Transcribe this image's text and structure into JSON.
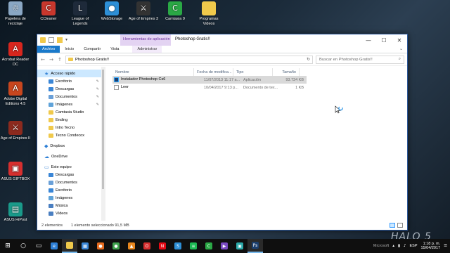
{
  "desktop_icons": [
    {
      "label": "Papelera de reciclaje",
      "icon": "recycle-bin-icon",
      "color": "#8aa7c4",
      "glyph": "♲"
    },
    {
      "label": "CCleaner",
      "icon": "ccleaner-icon",
      "color": "#c8372d",
      "glyph": "C"
    },
    {
      "label": "League of Legends",
      "icon": "league-of-legends-icon",
      "color": "#1e2a3a",
      "glyph": "L"
    },
    {
      "label": "WebStorage",
      "icon": "webstorage-icon",
      "color": "#2d8fd6",
      "glyph": "●"
    },
    {
      "label": "Age of Empires 3",
      "icon": "age-of-empires-3-icon",
      "color": "#333333",
      "glyph": "⚔"
    },
    {
      "label": "Camtasia 9",
      "icon": "camtasia-icon",
      "color": "#2aa845",
      "glyph": "C"
    },
    {
      "label": "Programas Videos",
      "icon": "folder-icon",
      "color": "#f0c94b",
      "glyph": ""
    },
    {
      "label": "Acrobat Reader DC",
      "icon": "acrobat-reader-icon",
      "color": "#d7261e",
      "glyph": "A"
    },
    {
      "label": "Adobe Digital Editions 4.5",
      "icon": "adobe-digital-editions-icon",
      "color": "#c8461e",
      "glyph": "A"
    },
    {
      "label": "Age of Empires II",
      "icon": "age-of-empires-2-icon",
      "color": "#8c2a1e",
      "glyph": "⚔"
    },
    {
      "label": "ASUS GIFTBOX",
      "icon": "asus-giftbox-icon",
      "color": "#d62f2f",
      "glyph": "▣"
    },
    {
      "label": "ASUS HiPost",
      "icon": "asus-hipost-icon",
      "color": "#1a9a8a",
      "glyph": "▤"
    }
  ],
  "window": {
    "context_tab": "Herramientas de aplicación",
    "title": "Photoshop Gratis!!",
    "controls": {
      "minimize": "—",
      "maximize": "☐",
      "close": "✕"
    }
  },
  "ribbon": {
    "tabs": [
      "Archivo",
      "Inicio",
      "Compartir",
      "Vista"
    ],
    "manage": "Administrar",
    "expand": "⌄"
  },
  "address": {
    "back": "←",
    "forward": "→",
    "up": "↑",
    "path": "Photoshop Gratis!!",
    "refresh": "↻",
    "search_placeholder": "Buscar en Photoshop Gratis!!",
    "search_icon": "⌕"
  },
  "nav": {
    "quick_access": "Acceso rápido",
    "quick_items": [
      {
        "label": "Escritorio",
        "icon": "desktop-icon",
        "color": "#3a86d6",
        "pinned": true
      },
      {
        "label": "Descargas",
        "icon": "downloads-icon",
        "color": "#3a86d6",
        "pinned": true
      },
      {
        "label": "Documentos",
        "icon": "documents-icon",
        "color": "#6aa0d8",
        "pinned": true
      },
      {
        "label": "Imágenes",
        "icon": "pictures-icon",
        "color": "#5fa3d9",
        "pinned": true
      },
      {
        "label": "Camtasia Studio",
        "icon": "folder-icon",
        "color": "#f0c94b",
        "pinned": false
      },
      {
        "label": "Ending",
        "icon": "folder-icon",
        "color": "#f0c94b",
        "pinned": false
      },
      {
        "label": "Intro Tecno",
        "icon": "folder-icon",
        "color": "#f0c94b",
        "pinned": false
      },
      {
        "label": "Tecno Condecox",
        "icon": "folder-icon",
        "color": "#f0c94b",
        "pinned": false
      }
    ],
    "pin_glyph": "✎",
    "dropbox": "Dropbox",
    "onedrive": "OneDrive",
    "this_pc": "Este equipo",
    "pc_items": [
      {
        "label": "Descargas",
        "icon": "downloads-icon",
        "color": "#3a86d6"
      },
      {
        "label": "Documentos",
        "icon": "documents-icon",
        "color": "#6aa0d8"
      },
      {
        "label": "Escritorio",
        "icon": "desktop-icon",
        "color": "#3a86d6"
      },
      {
        "label": "Imágenes",
        "icon": "pictures-icon",
        "color": "#5fa3d9"
      },
      {
        "label": "Música",
        "icon": "music-icon",
        "color": "#4a7fc1"
      },
      {
        "label": "Vídeos",
        "icon": "videos-icon",
        "color": "#4a7fc1"
      }
    ]
  },
  "columns": {
    "name": "Nombre",
    "date": "Fecha de modifica...",
    "type": "Tipo",
    "size": "Tamaño"
  },
  "files": [
    {
      "name": "Instalador Photoshop Cs6",
      "date": "11/07/2013 11:17 a...",
      "type": "Aplicación",
      "size": "93.734 KB",
      "icon": "photoshop-app-icon",
      "selected": true
    },
    {
      "name": "Leer",
      "date": "10/04/2017 9:13 p...",
      "type": "Documento de tex...",
      "size": "1 KB",
      "icon": "text-file-icon",
      "selected": false
    }
  ],
  "status": {
    "count": "2 elementos",
    "selection": "1 elemento seleccionado  91,5 MB"
  },
  "watermark": "HALO 5",
  "taskbar": {
    "apps": [
      {
        "icon": "start-icon",
        "color": "#ffffff",
        "glyph": "⊞"
      },
      {
        "icon": "search-icon",
        "color": "#ffffff",
        "glyph": "○"
      },
      {
        "icon": "task-view-icon",
        "color": "#ffffff",
        "glyph": "▭"
      },
      {
        "icon": "edge-icon",
        "color": "#2d7fd6",
        "glyph": "e"
      },
      {
        "icon": "explorer-icon",
        "color": "#f0c94b",
        "glyph": ""
      },
      {
        "icon": "store-icon",
        "color": "#3a86d6",
        "glyph": "▦"
      },
      {
        "icon": "firefox-icon",
        "color": "#e66b1e",
        "glyph": "●"
      },
      {
        "icon": "chrome-icon",
        "color": "#3fa34d",
        "glyph": "●"
      },
      {
        "icon": "vlc-icon",
        "color": "#e8871e",
        "glyph": "▲"
      },
      {
        "icon": "opera-icon",
        "color": "#d62f2f",
        "glyph": "O"
      },
      {
        "icon": "netflix-icon",
        "color": "#e50914",
        "glyph": "N"
      },
      {
        "icon": "skype-icon",
        "color": "#2d8fd6",
        "glyph": "S"
      },
      {
        "icon": "spotify-icon",
        "color": "#1db954",
        "glyph": "≡"
      },
      {
        "icon": "camtasia-icon",
        "color": "#2aa845",
        "glyph": "C"
      },
      {
        "icon": "media-player-icon",
        "color": "#7a4ac1",
        "glyph": "▶"
      },
      {
        "icon": "screen-recorder-icon",
        "color": "#2aa8a8",
        "glyph": "▣"
      },
      {
        "icon": "photoshop-taskbar-icon",
        "color": "#1c3f6e",
        "glyph": "Ps"
      }
    ],
    "tray": {
      "lang": "ESP",
      "time": "1:18 p. m.",
      "date": "15/04/2017",
      "tray_label": "Microsoft"
    }
  }
}
